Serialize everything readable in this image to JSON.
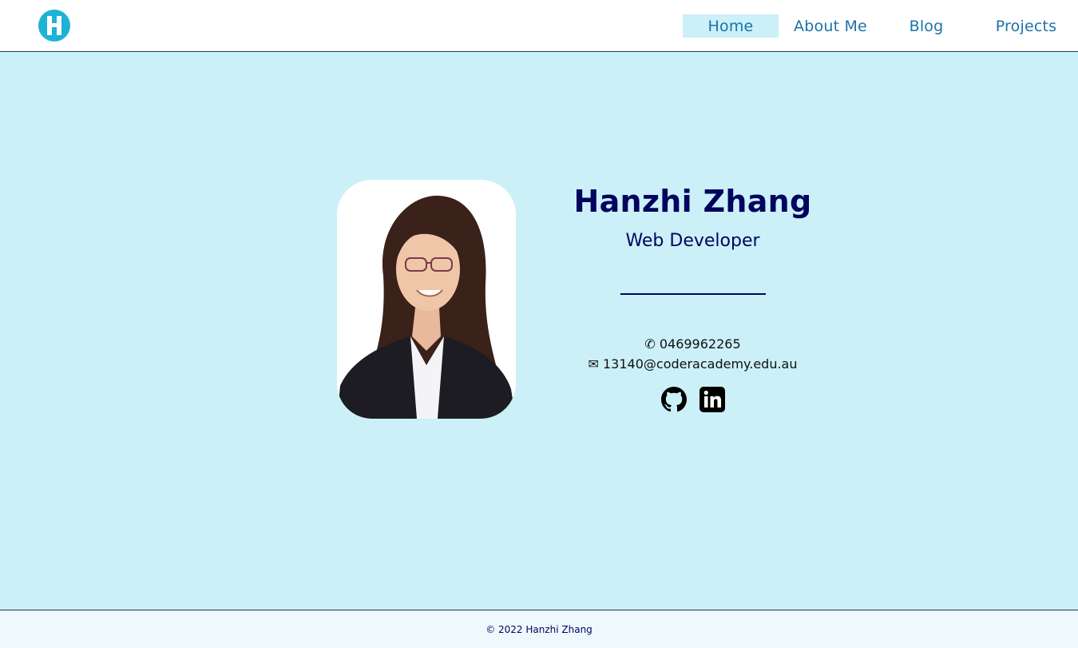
{
  "header": {
    "logo_letter": "H",
    "nav": [
      {
        "label": "Home"
      },
      {
        "label": "About Me"
      },
      {
        "label": "Blog"
      },
      {
        "label": "Projects"
      }
    ]
  },
  "profile": {
    "name": "Hanzhi Zhang",
    "role": "Web Developer",
    "phone": "✆ 0469962265",
    "email": "✉ 13140@coderacademy.edu.au",
    "social": [
      {
        "icon": "github-icon"
      },
      {
        "icon": "linkedin-icon"
      }
    ]
  },
  "footer": {
    "copyright": "© 2022 Hanzhi Zhang"
  },
  "colors": {
    "accent": "#1db3d4",
    "background": "#cbf0f8",
    "heading": "#03045e",
    "nav_text": "#1a73a8"
  }
}
